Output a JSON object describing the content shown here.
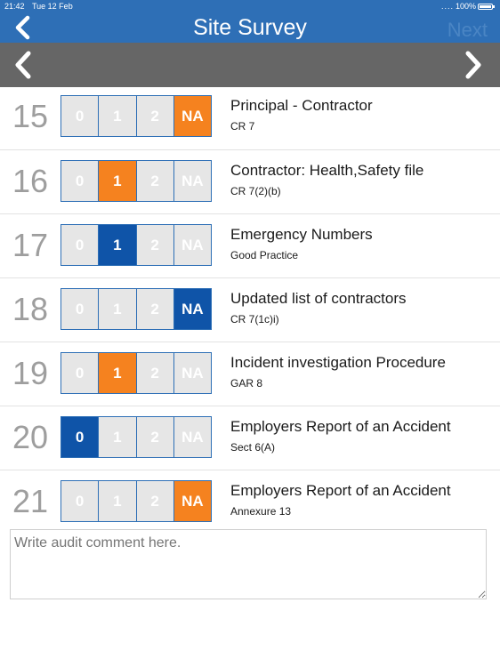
{
  "status_bar": {
    "time": "21:42",
    "date": "Tue 12 Feb",
    "signal": "....",
    "battery": "100%"
  },
  "nav": {
    "title": "Site Survey",
    "next_label": "Next",
    "back_icon": "chevron-left-icon"
  },
  "pager": {
    "prev_icon": "chevron-left-icon",
    "next_icon": "chevron-right-icon"
  },
  "options": [
    "0",
    "1",
    "2",
    "NA"
  ],
  "colors": {
    "header": "#2e6fb6",
    "pager": "#666666",
    "orange": "#f5821f",
    "blue": "#0f54a8",
    "unselected": "#e6e6e6"
  },
  "items": [
    {
      "number": "15",
      "title": "Principal - Contractor",
      "ref": "CR 7",
      "selected": "NA",
      "color": "orange"
    },
    {
      "number": "16",
      "title": "Contractor: Health,Safety file",
      "ref": "CR 7(2)(b)",
      "selected": "1",
      "color": "orange"
    },
    {
      "number": "17",
      "title": "Emergency Numbers",
      "ref": "Good Practice",
      "selected": "1",
      "color": "blue"
    },
    {
      "number": "18",
      "title": "Updated list of contractors",
      "ref": "CR 7(1c)i)",
      "selected": "NA",
      "color": "blue"
    },
    {
      "number": "19",
      "title": "Incident investigation Procedure",
      "ref": "GAR 8",
      "selected": "1",
      "color": "orange"
    },
    {
      "number": "20",
      "title": "Employers Report of an Accident",
      "ref": "Sect 6(A)",
      "selected": "0",
      "color": "blue"
    },
    {
      "number": "21",
      "title": "Employers Report of an Accident",
      "ref": "Annexure 13",
      "selected": "NA",
      "color": "orange"
    }
  ],
  "comment": {
    "placeholder": "Write audit comment here.",
    "value": ""
  }
}
